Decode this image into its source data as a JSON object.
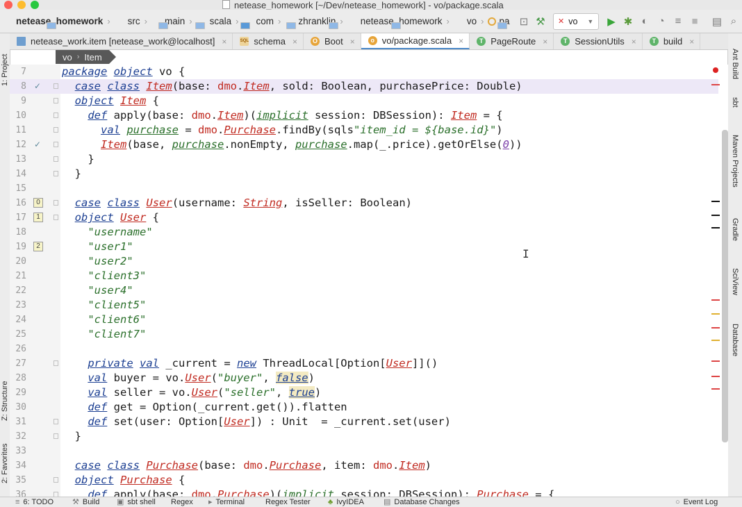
{
  "window": {
    "title": "netease_homework [~/Dev/netease_homework] - vo/package.scala"
  },
  "navbar": {
    "breadcrumbs": [
      "netease_homework",
      "src",
      "main",
      "scala",
      "com",
      "zhranklin",
      "netease_homework",
      "vo",
      "pa"
    ],
    "run_config": "vo"
  },
  "tabs": [
    {
      "label": "netease_work.item [netease_work@localhost]",
      "icon": "database-table-icon"
    },
    {
      "label": "schema",
      "icon": "sql-icon"
    },
    {
      "label": "Boot",
      "icon": "object-icon"
    },
    {
      "label": "vo/package.scala",
      "icon": "package-object-icon",
      "active": true
    },
    {
      "label": "PageRoute",
      "icon": "trait-icon"
    },
    {
      "label": "SessionUtils",
      "icon": "trait-icon"
    },
    {
      "label": "build",
      "icon": "trait-icon"
    }
  ],
  "editor_breadcrumb": [
    "vo",
    "Item"
  ],
  "left_tool_windows": [
    "1: Project",
    "Z: Structure",
    "2: Favorites"
  ],
  "right_tool_windows": [
    "Ant Build",
    "sbt",
    "Maven Projects",
    "Gradle",
    "SciView",
    "Database"
  ],
  "code": {
    "lines": [
      {
        "n": "7",
        "gutter": "",
        "text": "package object vo {"
      },
      {
        "n": "8",
        "gutter": "check",
        "text": "  case class Item(base: dmo.Item, sold: Boolean, purchasePrice: Double)"
      },
      {
        "n": "9",
        "gutter": "",
        "text": "  object Item {"
      },
      {
        "n": "10",
        "gutter": "",
        "text": "    def apply(base: dmo.Item)(implicit session: DBSession): Item = {"
      },
      {
        "n": "11",
        "gutter": "",
        "text": "      val purchase = dmo.Purchase.findBy(sqls\"item_id = ${base.id}\")"
      },
      {
        "n": "12",
        "gutter": "check",
        "text": "      Item(base, purchase.nonEmpty, purchase.map(_.price).getOrElse(0))"
      },
      {
        "n": "13",
        "gutter": "",
        "text": "    }"
      },
      {
        "n": "14",
        "gutter": "",
        "text": "  }"
      },
      {
        "n": "15",
        "gutter": "",
        "text": ""
      },
      {
        "n": "16",
        "gutter": "0",
        "text": "  case class User(username: String, isSeller: Boolean)"
      },
      {
        "n": "17",
        "gutter": "1",
        "text": "  object User {"
      },
      {
        "n": "18",
        "gutter": "",
        "text": "    \"username\""
      },
      {
        "n": "19",
        "gutter": "2",
        "text": "    \"user1\""
      },
      {
        "n": "20",
        "gutter": "",
        "text": "    \"user2\""
      },
      {
        "n": "21",
        "gutter": "",
        "text": "    \"client3\""
      },
      {
        "n": "22",
        "gutter": "",
        "text": "    \"user4\""
      },
      {
        "n": "23",
        "gutter": "",
        "text": "    \"client5\""
      },
      {
        "n": "24",
        "gutter": "",
        "text": "    \"client6\""
      },
      {
        "n": "25",
        "gutter": "",
        "text": "    \"client7\""
      },
      {
        "n": "26",
        "gutter": "",
        "text": ""
      },
      {
        "n": "27",
        "gutter": "",
        "text": "    private val _current = new ThreadLocal[Option[User]]()"
      },
      {
        "n": "28",
        "gutter": "",
        "text": "    val buyer = vo.User(\"buyer\", false)"
      },
      {
        "n": "29",
        "gutter": "",
        "text": "    val seller = vo.User(\"seller\", true)"
      },
      {
        "n": "30",
        "gutter": "",
        "text": "    def get = Option(_current.get()).flatten"
      },
      {
        "n": "31",
        "gutter": "",
        "text": "    def set(user: Option[User]) : Unit  = _current.set(user)"
      },
      {
        "n": "32",
        "gutter": "",
        "text": "  }"
      },
      {
        "n": "33",
        "gutter": "",
        "text": ""
      },
      {
        "n": "34",
        "gutter": "",
        "text": "  case class Purchase(base: dmo.Purchase, item: dmo.Item)"
      },
      {
        "n": "35",
        "gutter": "",
        "text": "  object Purchase {"
      },
      {
        "n": "36",
        "gutter": "",
        "text": "    def apply(base: dmo.Purchase)(implicit session: DBSession): Purchase = {"
      }
    ]
  },
  "bottombar": {
    "items": [
      "6: TODO",
      "Build",
      "sbt shell",
      "Regex",
      "Terminal",
      "Regex Tester",
      "IvyIDEA",
      "Database Changes"
    ],
    "event_log": "Event Log"
  },
  "colors": {
    "keyword": "#1c3f92",
    "string": "#2a6f2a",
    "type": "#c0291f",
    "current_line": "#ede8f7",
    "breadcrumb_bg": "#585858"
  }
}
